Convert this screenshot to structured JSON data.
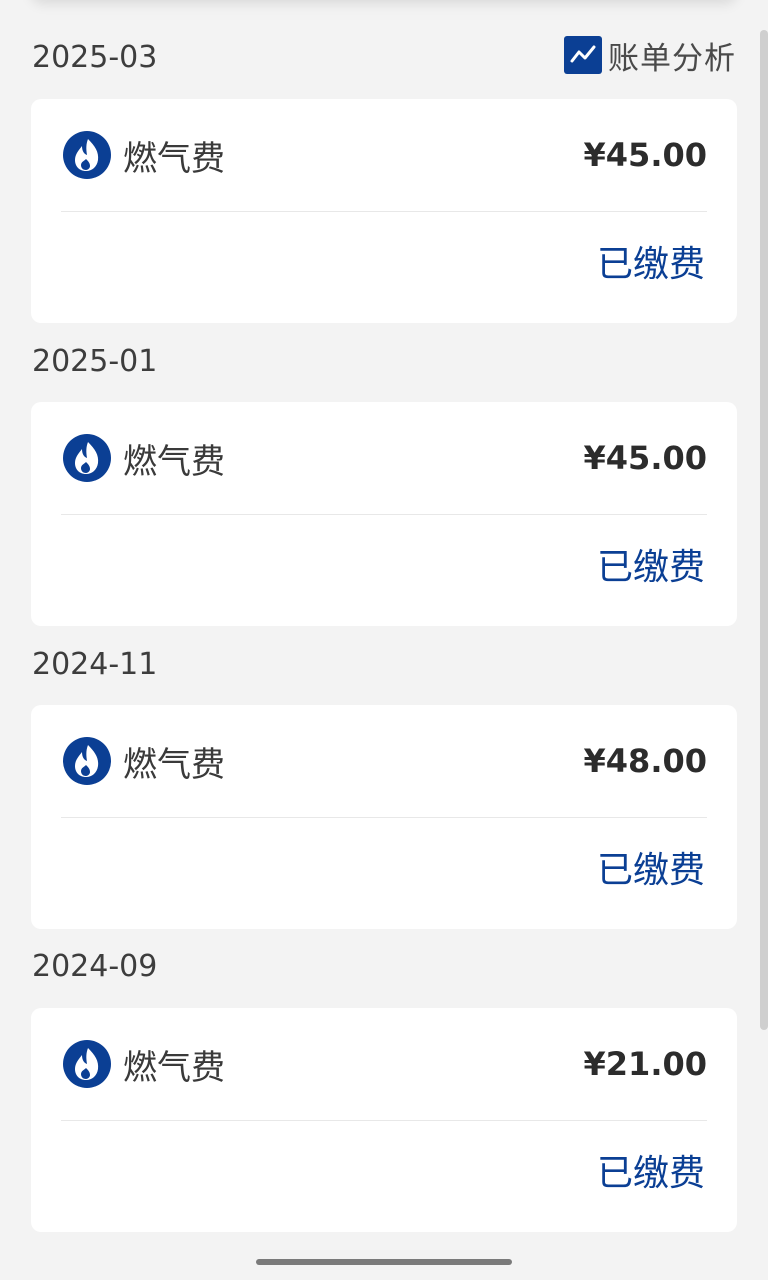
{
  "header": {
    "analysis_label": "账单分析",
    "analysis_icon": "trend-chart-icon"
  },
  "colors": {
    "accent": "#0b3f94",
    "background": "#f3f3f3",
    "card": "#ffffff"
  },
  "bills": [
    {
      "month": "2025-03",
      "name": "燃气费",
      "amount": "¥45.00",
      "status": "已缴费",
      "icon": "flame-icon"
    },
    {
      "month": "2025-01",
      "name": "燃气费",
      "amount": "¥45.00",
      "status": "已缴费",
      "icon": "flame-icon"
    },
    {
      "month": "2024-11",
      "name": "燃气费",
      "amount": "¥48.00",
      "status": "已缴费",
      "icon": "flame-icon"
    },
    {
      "month": "2024-09",
      "name": "燃气费",
      "amount": "¥21.00",
      "status": "已缴费",
      "icon": "flame-icon"
    }
  ]
}
